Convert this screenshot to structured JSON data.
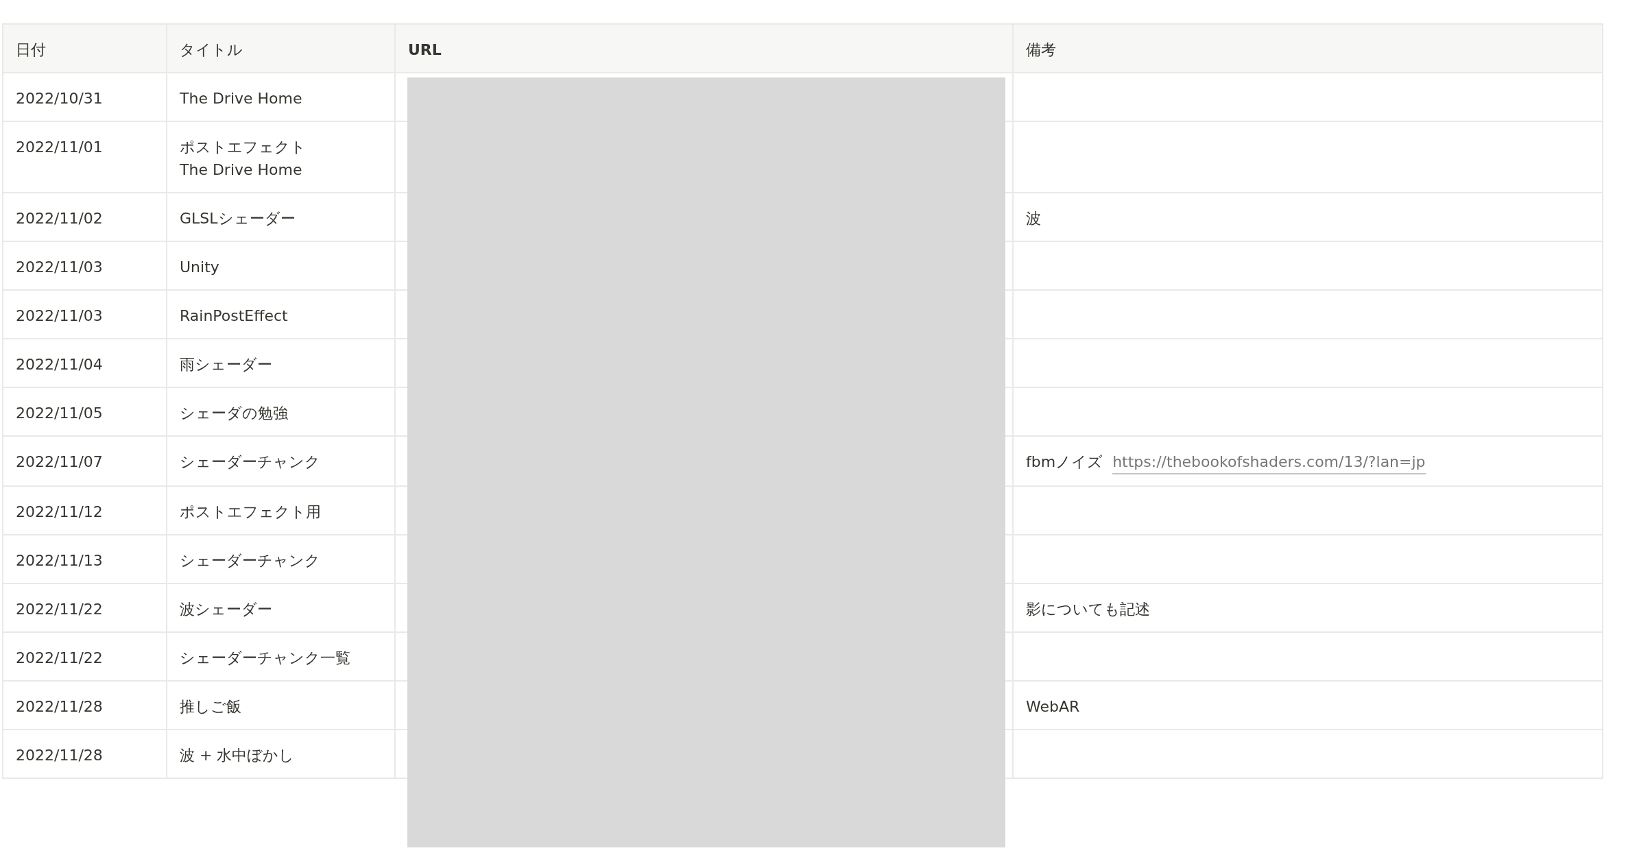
{
  "table": {
    "columns": [
      "日付",
      "タイトル",
      "URL",
      "備考"
    ],
    "rows": [
      {
        "date": "2022/10/31",
        "title": [
          "The Drive Home"
        ],
        "note": null
      },
      {
        "date": "2022/11/01",
        "title": [
          "ポストエフェクト",
          "The Drive Home"
        ],
        "note": null
      },
      {
        "date": "2022/11/02",
        "title": [
          "GLSLシェーダー"
        ],
        "note": {
          "text": "波"
        }
      },
      {
        "date": "2022/11/03",
        "title": [
          "Unity"
        ],
        "note": null
      },
      {
        "date": "2022/11/03",
        "title": [
          "RainPostEffect"
        ],
        "note": null
      },
      {
        "date": "2022/11/04",
        "title": [
          "雨シェーダー"
        ],
        "note": null
      },
      {
        "date": "2022/11/05",
        "title": [
          "シェーダの勉強"
        ],
        "note": null
      },
      {
        "date": "2022/11/07",
        "title": [
          "シェーダーチャンク"
        ],
        "note": {
          "text": "fbmノイズ",
          "link": "https://thebookofshaders.com/13/?lan=jp"
        }
      },
      {
        "date": "2022/11/12",
        "title": [
          "ポストエフェクト用"
        ],
        "note": null
      },
      {
        "date": "2022/11/13",
        "title": [
          "シェーダーチャンク"
        ],
        "note": null
      },
      {
        "date": "2022/11/22",
        "title": [
          "波シェーダー"
        ],
        "note": {
          "text": "影についても記述"
        }
      },
      {
        "date": "2022/11/22",
        "title": [
          "シェーダーチャンク一覧"
        ],
        "note": null
      },
      {
        "date": "2022/11/28",
        "title": [
          "推しご飯"
        ],
        "note": {
          "text": "WebAR"
        }
      },
      {
        "date": "2022/11/28",
        "title": [
          "波 + 水中ぼかし"
        ],
        "note": null
      }
    ]
  }
}
